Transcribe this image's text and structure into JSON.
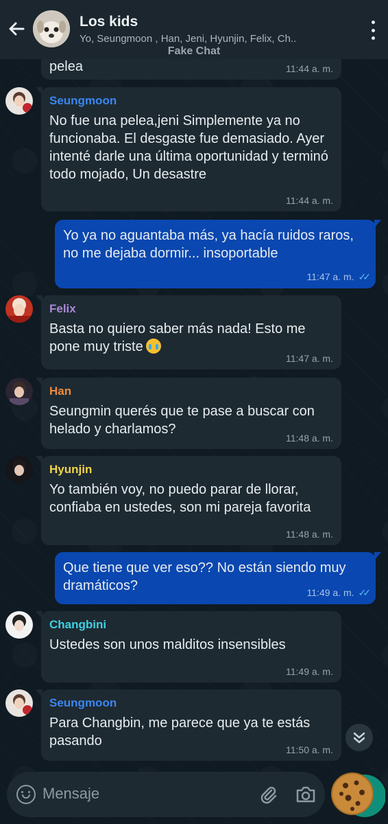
{
  "header": {
    "title": "Los kids",
    "subtitle": "Yo, Seungmoon , Han, Jeni, Hyunjin, Felix, Ch..",
    "watermark": "Fake Chat"
  },
  "messages": [
    {
      "direction": "in",
      "sender": "",
      "text": "pelea",
      "time": "11:44 a. m."
    },
    {
      "direction": "in",
      "sender": "Seungmoon",
      "sender_color": "#3b86f0",
      "text": "No fue una pelea,jeni Simplemente ya no funcionaba. El desgaste fue demasiado. Ayer intenté darle una última oportunidad y terminó todo mojado, Un desastre",
      "time": "11:44 a. m."
    },
    {
      "direction": "out",
      "text": "Yo ya no aguantaba más, ya hacía ruidos raros, no me dejaba dormir... insoportable",
      "time": "11:47 a. m."
    },
    {
      "direction": "in",
      "sender": "Felix",
      "sender_color": "#a98ad8",
      "text": "Basta no quiero saber más nada! Esto me pone muy triste",
      "time": "11:47 a. m.",
      "emoji": "crying-face-icon"
    },
    {
      "direction": "in",
      "sender": "Han",
      "sender_color": "#f08a3c",
      "text": "Seungmin querés que te pase a buscar con helado y charlamos?",
      "time": "11:48 a. m."
    },
    {
      "direction": "in",
      "sender": "Hyunjin",
      "sender_color": "#f2d64a",
      "text": "Yo también voy, no puedo parar de llorar, confiaba en ustedes, son mi pareja favorita",
      "time": "11:48 a. m."
    },
    {
      "direction": "out",
      "text": "Que tiene que ver eso?? No están siendo muy dramáticos?",
      "time": "11:49 a. m."
    },
    {
      "direction": "in",
      "sender": "Changbini",
      "sender_color": "#3fd0e0",
      "text": "Ustedes son unos malditos insensibles",
      "time": "11:49 a. m."
    },
    {
      "direction": "in",
      "sender": "Seungmoon",
      "sender_color": "#3b86f0",
      "text": "Para Changbin, me parece que ya te estás pasando",
      "time": "11:50 a. m."
    }
  ],
  "input": {
    "placeholder": "Mensaje"
  },
  "colors": {
    "header_bg": "#1b262e",
    "incoming_bubble": "#1e2a32",
    "outgoing_bubble": "#0a47b0",
    "read_check": "#5eb7f4"
  }
}
